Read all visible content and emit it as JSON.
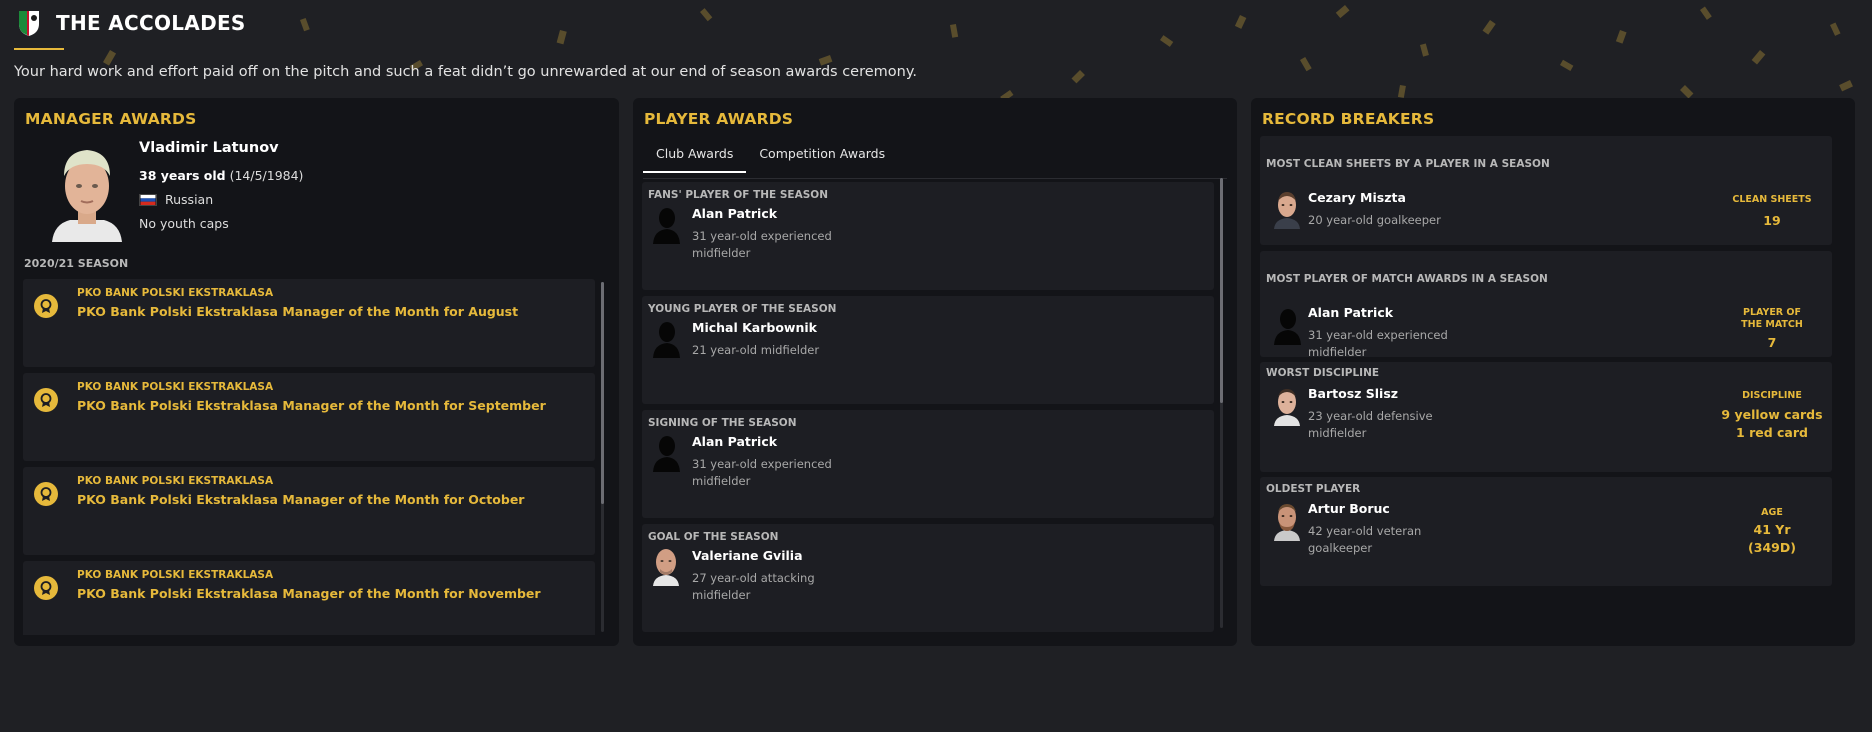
{
  "header": {
    "title": "THE ACCOLADES",
    "subtitle": "Your hard work and effort paid off on the pitch and such a feat didn’t go unrewarded at our end of season awards ceremony."
  },
  "colors": {
    "accent": "#e6b93b",
    "background": "#1f2024",
    "panel": "#131418",
    "card": "#1d1e23"
  },
  "manager_awards": {
    "title": "MANAGER AWARDS",
    "manager": {
      "name": "Vladimir Latunov",
      "age": "38 years old",
      "dob": "(14/5/1984)",
      "nationality": "Russian",
      "flag_icon": "russia-flag-icon",
      "youth_caps": "No youth caps"
    },
    "season_label": "2020/21 SEASON",
    "awards": [
      {
        "competition": "PKO BANK POLSKI EKSTRAKLASA",
        "award": "PKO Bank Polski Ekstraklasa Manager of the Month for August",
        "icon": "medal-icon"
      },
      {
        "competition": "PKO BANK POLSKI EKSTRAKLASA",
        "award": "PKO Bank Polski Ekstraklasa Manager of the Month for September",
        "icon": "medal-icon"
      },
      {
        "competition": "PKO BANK POLSKI EKSTRAKLASA",
        "award": "PKO Bank Polski Ekstraklasa Manager of the Month for October",
        "icon": "medal-icon"
      },
      {
        "competition": "PKO BANK POLSKI EKSTRAKLASA",
        "award": "PKO Bank Polski Ekstraklasa Manager of the Month for November",
        "icon": "medal-icon"
      }
    ]
  },
  "player_awards": {
    "title": "PLAYER AWARDS",
    "tabs": [
      {
        "label": "Club Awards",
        "active": true
      },
      {
        "label": "Competition Awards",
        "active": false
      }
    ],
    "awards": [
      {
        "label": "FANS' PLAYER OF THE SEASON",
        "name": "Alan Patrick",
        "desc": "31 year-old experienced midfielder",
        "photo": "silhouette"
      },
      {
        "label": "YOUNG PLAYER OF THE SEASON",
        "name": "Michal Karbownik",
        "desc": "21 year-old midfielder",
        "photo": "silhouette"
      },
      {
        "label": "SIGNING OF THE SEASON",
        "name": "Alan Patrick",
        "desc": "31 year-old experienced midfielder",
        "photo": "silhouette"
      },
      {
        "label": "GOAL OF THE SEASON",
        "name": "Valeriane Gvilia",
        "desc": "27 year-old attacking midfielder",
        "photo": "face"
      }
    ]
  },
  "record_breakers": {
    "title": "RECORD BREAKERS",
    "records": [
      {
        "label": "MOST CLEAN SHEETS BY A PLAYER IN A SEASON",
        "name": "Cezary Miszta",
        "desc": "20 year-old goalkeeper",
        "stat_label": "CLEAN SHEETS",
        "stat_value": "19"
      },
      {
        "label": "MOST PLAYER OF MATCH AWARDS IN A SEASON",
        "name": "Alan Patrick",
        "desc": "31 year-old experienced midfielder",
        "stat_label": "PLAYER OF THE MATCH",
        "stat_value": "7"
      },
      {
        "label": "WORST DISCIPLINE",
        "name": "Bartosz Slisz",
        "desc": "23 year-old defensive midfielder",
        "stat_label": "DISCIPLINE",
        "stat_value": "9 yellow cards",
        "stat_value_2": "1 red card"
      },
      {
        "label": "OLDEST PLAYER",
        "name": "Artur Boruc",
        "desc": "42 year-old veteran goalkeeper",
        "stat_label": "AGE",
        "stat_value": "41 Yr",
        "stat_value_2": "(349D)"
      }
    ]
  }
}
